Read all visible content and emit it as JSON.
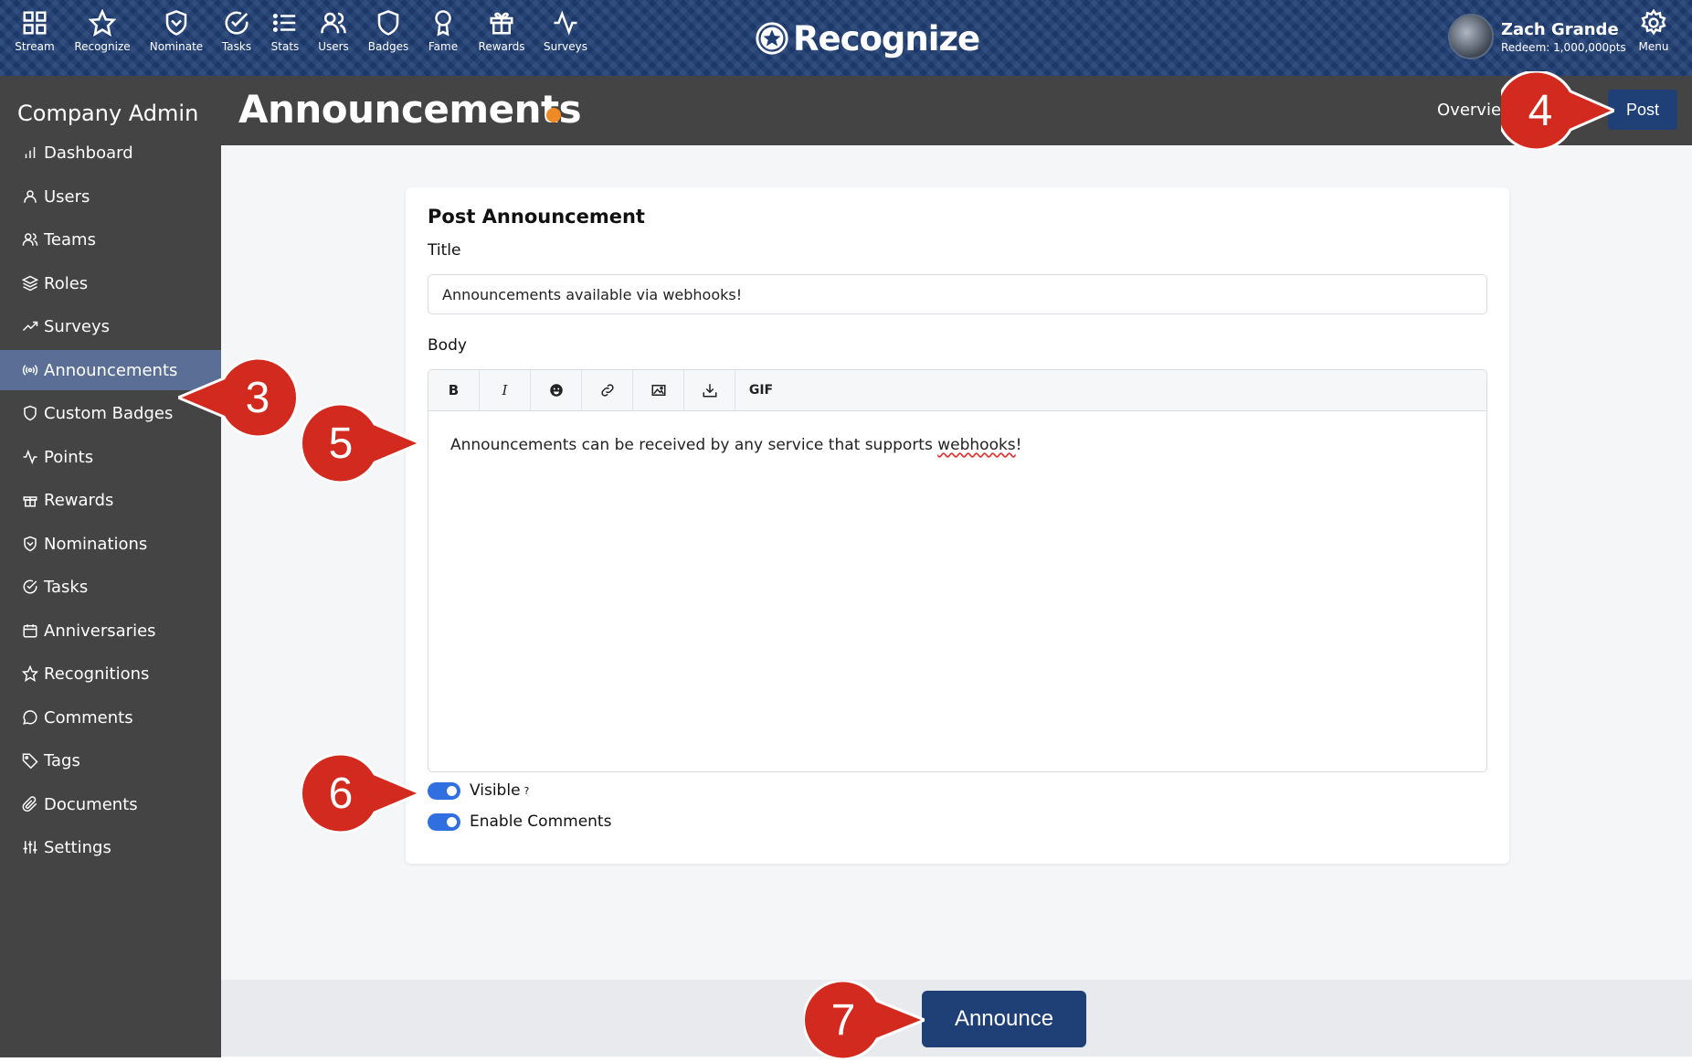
{
  "topnav": {
    "items": [
      {
        "label": "Stream",
        "icon": "grid-icon"
      },
      {
        "label": "Recognize",
        "icon": "star-icon"
      },
      {
        "label": "Nominate",
        "icon": "shield-heart-icon"
      },
      {
        "label": "Tasks",
        "icon": "check-circle-icon"
      },
      {
        "label": "Stats",
        "icon": "list-icon"
      },
      {
        "label": "Users",
        "icon": "users-icon"
      },
      {
        "label": "Badges",
        "icon": "shield-icon"
      },
      {
        "label": "Fame",
        "icon": "award-icon"
      },
      {
        "label": "Rewards",
        "icon": "gift-icon"
      },
      {
        "label": "Surveys",
        "icon": "activity-icon"
      }
    ],
    "brand": "Recognize",
    "user_name": "Zach Grande",
    "user_points": "Redeem: 1,000,000pts",
    "menu_label": "Menu"
  },
  "sidebar": {
    "title": "Company Admin",
    "items": [
      {
        "label": "Dashboard",
        "icon": "bar-chart-icon"
      },
      {
        "label": "Users",
        "icon": "user-icon"
      },
      {
        "label": "Teams",
        "icon": "users-icon"
      },
      {
        "label": "Roles",
        "icon": "layers-icon"
      },
      {
        "label": "Surveys",
        "icon": "trending-up-icon"
      },
      {
        "label": "Announcements",
        "icon": "broadcast-icon",
        "active": true
      },
      {
        "label": "Custom Badges",
        "icon": "shield-icon"
      },
      {
        "label": "Points",
        "icon": "activity-icon"
      },
      {
        "label": "Rewards",
        "icon": "gift-icon"
      },
      {
        "label": "Nominations",
        "icon": "shield-heart-icon"
      },
      {
        "label": "Tasks",
        "icon": "check-circle-icon"
      },
      {
        "label": "Anniversaries",
        "icon": "calendar-icon"
      },
      {
        "label": "Recognitions",
        "icon": "star-icon"
      },
      {
        "label": "Comments",
        "icon": "message-circle-icon"
      },
      {
        "label": "Tags",
        "icon": "tag-icon"
      },
      {
        "label": "Documents",
        "icon": "paperclip-icon"
      },
      {
        "label": "Settings",
        "icon": "sliders-icon"
      }
    ]
  },
  "header": {
    "title": "Announcements",
    "overview_label": "Overvie",
    "post_label": "Post",
    "dot_color": "#f08a24"
  },
  "form": {
    "card_title": "Post Announcement",
    "title_label": "Title",
    "title_value": "Announcements available via webhooks!",
    "body_label": "Body",
    "toolbar": {
      "bold": "B",
      "italic": "I",
      "gif": "GIF"
    },
    "body_text_before": "Announcements can be received by any service that supports ",
    "body_text_marked": "webhooks",
    "body_text_after": "!",
    "visible_label": "Visible",
    "visible_help": "?",
    "visible_on": true,
    "comments_label": "Enable Comments",
    "comments_on": true,
    "announce_label": "Announce"
  },
  "markers": {
    "m3": "3",
    "m4": "4",
    "m5": "5",
    "m6": "6",
    "m7": "7"
  },
  "colors": {
    "accent": "#1f3f77",
    "marker": "#d32a1f",
    "toggle": "#2f6fdf",
    "sidebar": "#444444",
    "active": "#5b6f96"
  }
}
